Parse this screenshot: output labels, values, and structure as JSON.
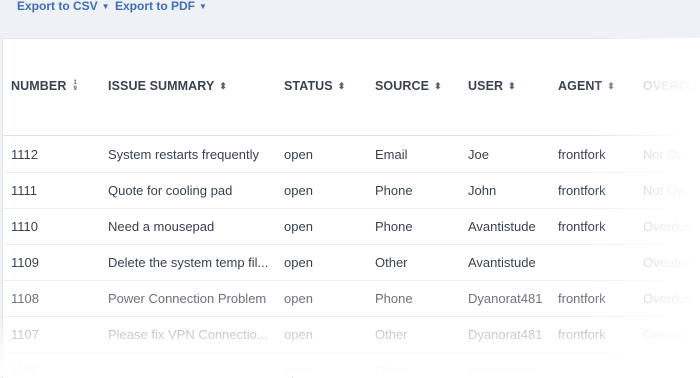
{
  "export": {
    "csv_label": "Export to CSV",
    "pdf_label": "Export to PDF"
  },
  "table": {
    "columns": [
      {
        "key": "number",
        "label": "NUMBER"
      },
      {
        "key": "summary",
        "label": "ISSUE SUMMARY"
      },
      {
        "key": "status",
        "label": "STATUS"
      },
      {
        "key": "source",
        "label": "SOURCE"
      },
      {
        "key": "user",
        "label": "USER"
      },
      {
        "key": "agent",
        "label": "AGENT"
      },
      {
        "key": "overdue",
        "label": "OVERDUE"
      }
    ],
    "rows": [
      {
        "number": "1112",
        "summary": "System restarts frequently",
        "status": "open",
        "source": "Email",
        "user": "Joe",
        "agent": "frontfork",
        "overdue": "Not Overdue"
      },
      {
        "number": "1111",
        "summary": "Quote for cooling pad",
        "status": "open",
        "source": "Phone",
        "user": "John",
        "agent": "frontfork",
        "overdue": "Not Overdue"
      },
      {
        "number": "1110",
        "summary": "Need a mousepad",
        "status": "open",
        "source": "Phone",
        "user": "Avantistude",
        "agent": "frontfork",
        "overdue": "Overdue"
      },
      {
        "number": "1109",
        "summary": "Delete the system temp fil...",
        "status": "open",
        "source": "Other",
        "user": "Avantistude",
        "agent": "",
        "overdue": "Overdue"
      },
      {
        "number": "1108",
        "summary": "Power Connection Problem",
        "status": "open",
        "source": "Phone",
        "user": "Dyanorat481",
        "agent": "frontfork",
        "overdue": "Overdue"
      },
      {
        "number": "1107",
        "summary": "Please fix VPN Connectio...",
        "status": "open",
        "source": "Other",
        "user": "Dyanorat481",
        "agent": "frontfork",
        "overdue": "Overdue"
      },
      {
        "number": "1106",
        "summary": "",
        "status": "open",
        "source": "Other",
        "user": "Avantistude",
        "agent": "",
        "overdue": "Overdue"
      }
    ]
  }
}
